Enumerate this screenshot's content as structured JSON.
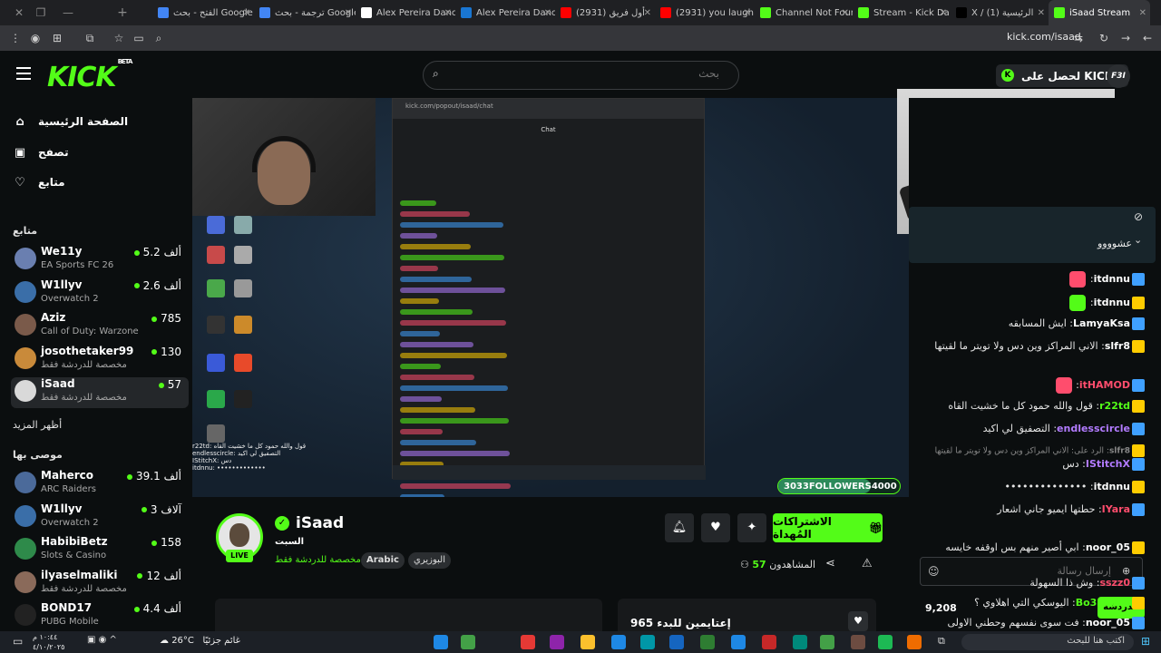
{
  "browser": {
    "tabs": [
      {
        "label": "",
        "color": "#2b2d30"
      },
      {
        "label": "الفتح - بحث Google",
        "color": "#4285f4"
      },
      {
        "label": "ترجمة - بحث Google",
        "color": "#4285f4"
      },
      {
        "label": "Alex Pereira Danc",
        "color": "#ffffff"
      },
      {
        "label": "Alex Pereira Danc",
        "color": "#1976d2"
      },
      {
        "label": "(2931) أول فريق",
        "color": "#ff0000"
      },
      {
        "label": "(2931) you laugh",
        "color": "#ff0000"
      },
      {
        "label": "Channel Not Foun",
        "color": "#53fc18"
      },
      {
        "label": "Stream - Kick Da",
        "color": "#53fc18"
      },
      {
        "label": "X / (1) الرئيسية",
        "color": "#000000"
      },
      {
        "label": "iSaad Stream",
        "color": "#53fc18"
      }
    ],
    "url": "kick.com/isaad"
  },
  "header": {
    "logo": "KICK",
    "logo_badge": "BETA",
    "search_placeholder": "بحث",
    "kicks_button": "لحصل على KICKs",
    "avatar_text": "F3I"
  },
  "sidebar": {
    "nav": [
      {
        "label": "الصفحة الرئيسية",
        "icon": "home-icon"
      },
      {
        "label": "تصفح",
        "icon": "browse-icon"
      },
      {
        "label": "متابع",
        "icon": "heart-icon"
      }
    ],
    "following_header": "متابع",
    "following": [
      {
        "name": "We11y",
        "sub": "EA Sports FC 26",
        "count": "5.2 ألف",
        "color": "#6a7fb0"
      },
      {
        "name": "W1llyv",
        "sub": "Overwatch 2",
        "count": "2.6 ألف",
        "color": "#3a6ea8"
      },
      {
        "name": "Aziz",
        "sub": "Call of Duty: Warzone",
        "count": "785",
        "color": "#7a5a4a"
      },
      {
        "name": "josothetaker99",
        "sub": "مخصصة للدردشة فقط",
        "count": "130",
        "color": "#c98a3a"
      },
      {
        "name": "iSaad",
        "sub": "مخصصة للدردشة فقط",
        "count": "57",
        "color": "#d9d9d9"
      }
    ],
    "show_more": "أظهر المزيد",
    "recommended_header": "موصى بها",
    "recommended": [
      {
        "name": "Maherco",
        "sub": "ARC Raiders",
        "count": "39.1 ألف",
        "color": "#4b6a9a"
      },
      {
        "name": "W1llyv",
        "sub": "Overwatch 2",
        "count": "3 آلاف",
        "color": "#3a6ea8"
      },
      {
        "name": "HabibiBetz",
        "sub": "Slots & Casino",
        "count": "158",
        "color": "#2e8a4a"
      },
      {
        "name": "ilyaselmaliki",
        "sub": "مخصصة للدردشة فقط",
        "count": "12 ألف",
        "color": "#8a6a5a"
      },
      {
        "name": "BOND17",
        "sub": "PUBG Mobile",
        "count": "4.4 ألف",
        "color": "#222222"
      }
    ]
  },
  "video": {
    "followers_label": "FOLLOWERS",
    "followers_current": "3033",
    "followers_goal": "4000",
    "followers_progress": 0.76,
    "overlay_lines": [
      "r22td: قول والله حمود كل ما خشيت القاه",
      "endlesscircle: التصفيق لي اكيد",
      "IStitchX: دس",
      "itdnnu: •••••••••••••"
    ]
  },
  "chat": {
    "pinned_text": "عشوووو",
    "messages": [
      {
        "user": "itdnnu",
        "text": "",
        "color": "#ffffff"
      },
      {
        "user": "itdnnu",
        "text": "",
        "color": "#ffffff"
      },
      {
        "user": "LamyaKsa",
        "text": "ايش المسابقه",
        "color": "#ffffff"
      },
      {
        "user": "slfr8",
        "text": "الاني المراكز وين دس ولا تويتر ما لقيتها",
        "color": "#ffffff"
      },
      {
        "user": "itHAMOD",
        "text": "",
        "color": "#ff4d6d"
      },
      {
        "user": "r22td",
        "text": "قول والله حمود كل ما خشيت القاه",
        "color": "#53fc18"
      },
      {
        "user": "endlesscircle",
        "text": "التصفيق لي اكيد",
        "color": "#b27bff"
      },
      {
        "user": "slfr8",
        "text": "الرد على: الاني المراكز وين دس ولا تويتر ما لقيتها",
        "color": "#888888"
      },
      {
        "user": "IStitchX",
        "text": "دس",
        "color": "#b27bff"
      },
      {
        "user": "itdnnu",
        "text": "••••••••••••••",
        "color": "#ffffff"
      },
      {
        "user": "IYara",
        "text": "حطتها ايميو جاني اشعار",
        "color": "#ff4d6d"
      },
      {
        "user": "noor_05",
        "text": "ابي أصير منهم بس اوقفه خايسه",
        "color": "#ffffff"
      },
      {
        "user": "sszz0",
        "text": "وش ذا السهولة",
        "color": "#ff4d6d"
      },
      {
        "user": "Bo3abdzx",
        "text": "اليوسكي التي اهلاوي ؟",
        "color": "#53fc18"
      },
      {
        "user": "noor_05",
        "text": "فت سوى نفسهم وحطني الاولى",
        "color": "#ffffff"
      }
    ],
    "input_placeholder": "إرسال رسالة",
    "send_label": "الدردشة",
    "points": "9,208"
  },
  "stream": {
    "name": "iSaad",
    "title": "السبت",
    "category": "مخصصة للدردشة فقط",
    "tags": [
      "Arabic",
      "البوزيري"
    ],
    "live_label": "LIVE",
    "subscribe_label": "الاشتراكات المُهداة",
    "viewers_label": "المشاهدون",
    "viewers_count": "57",
    "card_title": "إعتايمين للبدء 965"
  },
  "taskbar": {
    "weather_temp": "26°C",
    "weather_text": "غائم جزئيًا",
    "clock_time": "١٠:٤٤ م",
    "clock_date": "٤/١٠/٢٠٢٥",
    "search_placeholder": "اكتب هنا للبحث"
  }
}
